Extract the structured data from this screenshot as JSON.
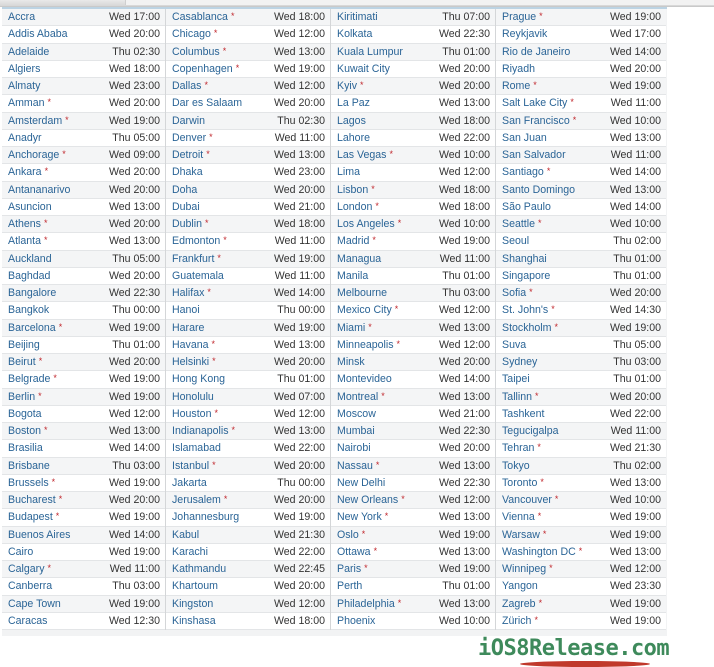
{
  "dst_marker": "*",
  "watermark": "iOS8Release.com",
  "columns": [
    [
      {
        "city": "Accra",
        "time": "Wed 17:00",
        "dst": false
      },
      {
        "city": "Addis Ababa",
        "time": "Wed 20:00",
        "dst": false
      },
      {
        "city": "Adelaide",
        "time": "Thu 02:30",
        "dst": false
      },
      {
        "city": "Algiers",
        "time": "Wed 18:00",
        "dst": false
      },
      {
        "city": "Almaty",
        "time": "Wed 23:00",
        "dst": false
      },
      {
        "city": "Amman",
        "time": "Wed 20:00",
        "dst": true
      },
      {
        "city": "Amsterdam",
        "time": "Wed 19:00",
        "dst": true
      },
      {
        "city": "Anadyr",
        "time": "Thu 05:00",
        "dst": false
      },
      {
        "city": "Anchorage",
        "time": "Wed 09:00",
        "dst": true
      },
      {
        "city": "Ankara",
        "time": "Wed 20:00",
        "dst": true
      },
      {
        "city": "Antananarivo",
        "time": "Wed 20:00",
        "dst": false
      },
      {
        "city": "Asuncion",
        "time": "Wed 13:00",
        "dst": false
      },
      {
        "city": "Athens",
        "time": "Wed 20:00",
        "dst": true
      },
      {
        "city": "Atlanta",
        "time": "Wed 13:00",
        "dst": true
      },
      {
        "city": "Auckland",
        "time": "Thu 05:00",
        "dst": false
      },
      {
        "city": "Baghdad",
        "time": "Wed 20:00",
        "dst": false
      },
      {
        "city": "Bangalore",
        "time": "Wed 22:30",
        "dst": false
      },
      {
        "city": "Bangkok",
        "time": "Thu 00:00",
        "dst": false
      },
      {
        "city": "Barcelona",
        "time": "Wed 19:00",
        "dst": true
      },
      {
        "city": "Beijing",
        "time": "Thu 01:00",
        "dst": false
      },
      {
        "city": "Beirut",
        "time": "Wed 20:00",
        "dst": true
      },
      {
        "city": "Belgrade",
        "time": "Wed 19:00",
        "dst": true
      },
      {
        "city": "Berlin",
        "time": "Wed 19:00",
        "dst": true
      },
      {
        "city": "Bogota",
        "time": "Wed 12:00",
        "dst": false
      },
      {
        "city": "Boston",
        "time": "Wed 13:00",
        "dst": true
      },
      {
        "city": "Brasilia",
        "time": "Wed 14:00",
        "dst": false
      },
      {
        "city": "Brisbane",
        "time": "Thu 03:00",
        "dst": false
      },
      {
        "city": "Brussels",
        "time": "Wed 19:00",
        "dst": true
      },
      {
        "city": "Bucharest",
        "time": "Wed 20:00",
        "dst": true
      },
      {
        "city": "Budapest",
        "time": "Wed 19:00",
        "dst": true
      },
      {
        "city": "Buenos Aires",
        "time": "Wed 14:00",
        "dst": false
      },
      {
        "city": "Cairo",
        "time": "Wed 19:00",
        "dst": false
      },
      {
        "city": "Calgary",
        "time": "Wed 11:00",
        "dst": true
      },
      {
        "city": "Canberra",
        "time": "Thu 03:00",
        "dst": false
      },
      {
        "city": "Cape Town",
        "time": "Wed 19:00",
        "dst": false
      },
      {
        "city": "Caracas",
        "time": "Wed 12:30",
        "dst": false
      }
    ],
    [
      {
        "city": "Casablanca",
        "time": "Wed 18:00",
        "dst": true
      },
      {
        "city": "Chicago",
        "time": "Wed 12:00",
        "dst": true
      },
      {
        "city": "Columbus",
        "time": "Wed 13:00",
        "dst": true
      },
      {
        "city": "Copenhagen",
        "time": "Wed 19:00",
        "dst": true
      },
      {
        "city": "Dallas",
        "time": "Wed 12:00",
        "dst": true
      },
      {
        "city": "Dar es Salaam",
        "time": "Wed 20:00",
        "dst": false
      },
      {
        "city": "Darwin",
        "time": "Thu 02:30",
        "dst": false
      },
      {
        "city": "Denver",
        "time": "Wed 11:00",
        "dst": true
      },
      {
        "city": "Detroit",
        "time": "Wed 13:00",
        "dst": true
      },
      {
        "city": "Dhaka",
        "time": "Wed 23:00",
        "dst": false
      },
      {
        "city": "Doha",
        "time": "Wed 20:00",
        "dst": false
      },
      {
        "city": "Dubai",
        "time": "Wed 21:00",
        "dst": false
      },
      {
        "city": "Dublin",
        "time": "Wed 18:00",
        "dst": true
      },
      {
        "city": "Edmonton",
        "time": "Wed 11:00",
        "dst": true
      },
      {
        "city": "Frankfurt",
        "time": "Wed 19:00",
        "dst": true
      },
      {
        "city": "Guatemala",
        "time": "Wed 11:00",
        "dst": false
      },
      {
        "city": "Halifax",
        "time": "Wed 14:00",
        "dst": true
      },
      {
        "city": "Hanoi",
        "time": "Thu 00:00",
        "dst": false
      },
      {
        "city": "Harare",
        "time": "Wed 19:00",
        "dst": false
      },
      {
        "city": "Havana",
        "time": "Wed 13:00",
        "dst": true
      },
      {
        "city": "Helsinki",
        "time": "Wed 20:00",
        "dst": true
      },
      {
        "city": "Hong Kong",
        "time": "Thu 01:00",
        "dst": false
      },
      {
        "city": "Honolulu",
        "time": "Wed 07:00",
        "dst": false
      },
      {
        "city": "Houston",
        "time": "Wed 12:00",
        "dst": true
      },
      {
        "city": "Indianapolis",
        "time": "Wed 13:00",
        "dst": true
      },
      {
        "city": "Islamabad",
        "time": "Wed 22:00",
        "dst": false
      },
      {
        "city": "Istanbul",
        "time": "Wed 20:00",
        "dst": true
      },
      {
        "city": "Jakarta",
        "time": "Thu 00:00",
        "dst": false
      },
      {
        "city": "Jerusalem",
        "time": "Wed 20:00",
        "dst": true
      },
      {
        "city": "Johannesburg",
        "time": "Wed 19:00",
        "dst": false
      },
      {
        "city": "Kabul",
        "time": "Wed 21:30",
        "dst": false
      },
      {
        "city": "Karachi",
        "time": "Wed 22:00",
        "dst": false
      },
      {
        "city": "Kathmandu",
        "time": "Wed 22:45",
        "dst": false
      },
      {
        "city": "Khartoum",
        "time": "Wed 20:00",
        "dst": false
      },
      {
        "city": "Kingston",
        "time": "Wed 12:00",
        "dst": false
      },
      {
        "city": "Kinshasa",
        "time": "Wed 18:00",
        "dst": false
      }
    ],
    [
      {
        "city": "Kiritimati",
        "time": "Thu 07:00",
        "dst": false
      },
      {
        "city": "Kolkata",
        "time": "Wed 22:30",
        "dst": false
      },
      {
        "city": "Kuala Lumpur",
        "time": "Thu 01:00",
        "dst": false
      },
      {
        "city": "Kuwait City",
        "time": "Wed 20:00",
        "dst": false
      },
      {
        "city": "Kyiv",
        "time": "Wed 20:00",
        "dst": true
      },
      {
        "city": "La Paz",
        "time": "Wed 13:00",
        "dst": false
      },
      {
        "city": "Lagos",
        "time": "Wed 18:00",
        "dst": false
      },
      {
        "city": "Lahore",
        "time": "Wed 22:00",
        "dst": false
      },
      {
        "city": "Las Vegas",
        "time": "Wed 10:00",
        "dst": true
      },
      {
        "city": "Lima",
        "time": "Wed 12:00",
        "dst": false
      },
      {
        "city": "Lisbon",
        "time": "Wed 18:00",
        "dst": true
      },
      {
        "city": "London",
        "time": "Wed 18:00",
        "dst": true
      },
      {
        "city": "Los Angeles",
        "time": "Wed 10:00",
        "dst": true
      },
      {
        "city": "Madrid",
        "time": "Wed 19:00",
        "dst": true
      },
      {
        "city": "Managua",
        "time": "Wed 11:00",
        "dst": false
      },
      {
        "city": "Manila",
        "time": "Thu 01:00",
        "dst": false
      },
      {
        "city": "Melbourne",
        "time": "Thu 03:00",
        "dst": false
      },
      {
        "city": "Mexico City",
        "time": "Wed 12:00",
        "dst": true
      },
      {
        "city": "Miami",
        "time": "Wed 13:00",
        "dst": true
      },
      {
        "city": "Minneapolis",
        "time": "Wed 12:00",
        "dst": true
      },
      {
        "city": "Minsk",
        "time": "Wed 20:00",
        "dst": false
      },
      {
        "city": "Montevideo",
        "time": "Wed 14:00",
        "dst": false
      },
      {
        "city": "Montreal",
        "time": "Wed 13:00",
        "dst": true
      },
      {
        "city": "Moscow",
        "time": "Wed 21:00",
        "dst": false
      },
      {
        "city": "Mumbai",
        "time": "Wed 22:30",
        "dst": false
      },
      {
        "city": "Nairobi",
        "time": "Wed 20:00",
        "dst": false
      },
      {
        "city": "Nassau",
        "time": "Wed 13:00",
        "dst": true
      },
      {
        "city": "New Delhi",
        "time": "Wed 22:30",
        "dst": false
      },
      {
        "city": "New Orleans",
        "time": "Wed 12:00",
        "dst": true
      },
      {
        "city": "New York",
        "time": "Wed 13:00",
        "dst": true
      },
      {
        "city": "Oslo",
        "time": "Wed 19:00",
        "dst": true
      },
      {
        "city": "Ottawa",
        "time": "Wed 13:00",
        "dst": true
      },
      {
        "city": "Paris",
        "time": "Wed 19:00",
        "dst": true
      },
      {
        "city": "Perth",
        "time": "Thu 01:00",
        "dst": false
      },
      {
        "city": "Philadelphia",
        "time": "Wed 13:00",
        "dst": true
      },
      {
        "city": "Phoenix",
        "time": "Wed 10:00",
        "dst": false
      }
    ],
    [
      {
        "city": "Prague",
        "time": "Wed 19:00",
        "dst": true
      },
      {
        "city": "Reykjavik",
        "time": "Wed 17:00",
        "dst": false
      },
      {
        "city": "Rio de Janeiro",
        "time": "Wed 14:00",
        "dst": false
      },
      {
        "city": "Riyadh",
        "time": "Wed 20:00",
        "dst": false
      },
      {
        "city": "Rome",
        "time": "Wed 19:00",
        "dst": true
      },
      {
        "city": "Salt Lake City",
        "time": "Wed 11:00",
        "dst": true
      },
      {
        "city": "San Francisco",
        "time": "Wed 10:00",
        "dst": true
      },
      {
        "city": "San Juan",
        "time": "Wed 13:00",
        "dst": false
      },
      {
        "city": "San Salvador",
        "time": "Wed 11:00",
        "dst": false
      },
      {
        "city": "Santiago",
        "time": "Wed 14:00",
        "dst": true
      },
      {
        "city": "Santo Domingo",
        "time": "Wed 13:00",
        "dst": false
      },
      {
        "city": "São Paulo",
        "time": "Wed 14:00",
        "dst": false
      },
      {
        "city": "Seattle",
        "time": "Wed 10:00",
        "dst": true
      },
      {
        "city": "Seoul",
        "time": "Thu 02:00",
        "dst": false
      },
      {
        "city": "Shanghai",
        "time": "Thu 01:00",
        "dst": false
      },
      {
        "city": "Singapore",
        "time": "Thu 01:00",
        "dst": false
      },
      {
        "city": "Sofia",
        "time": "Wed 20:00",
        "dst": true
      },
      {
        "city": "St. John's",
        "time": "Wed 14:30",
        "dst": true
      },
      {
        "city": "Stockholm",
        "time": "Wed 19:00",
        "dst": true
      },
      {
        "city": "Suva",
        "time": "Thu 05:00",
        "dst": false
      },
      {
        "city": "Sydney",
        "time": "Thu 03:00",
        "dst": false
      },
      {
        "city": "Taipei",
        "time": "Thu 01:00",
        "dst": false
      },
      {
        "city": "Tallinn",
        "time": "Wed 20:00",
        "dst": true
      },
      {
        "city": "Tashkent",
        "time": "Wed 22:00",
        "dst": false
      },
      {
        "city": "Tegucigalpa",
        "time": "Wed 11:00",
        "dst": false
      },
      {
        "city": "Tehran",
        "time": "Wed 21:30",
        "dst": true
      },
      {
        "city": "Tokyo",
        "time": "Thu 02:00",
        "dst": false
      },
      {
        "city": "Toronto",
        "time": "Wed 13:00",
        "dst": true
      },
      {
        "city": "Vancouver",
        "time": "Wed 10:00",
        "dst": true
      },
      {
        "city": "Vienna",
        "time": "Wed 19:00",
        "dst": true
      },
      {
        "city": "Warsaw",
        "time": "Wed 19:00",
        "dst": true
      },
      {
        "city": "Washington DC",
        "time": "Wed 13:00",
        "dst": true
      },
      {
        "city": "Winnipeg",
        "time": "Wed 12:00",
        "dst": true
      },
      {
        "city": "Yangon",
        "time": "Wed 23:30",
        "dst": false
      },
      {
        "city": "Zagreb",
        "time": "Wed 19:00",
        "dst": true
      },
      {
        "city": "Zürich",
        "time": "Wed 19:00",
        "dst": true
      }
    ]
  ]
}
